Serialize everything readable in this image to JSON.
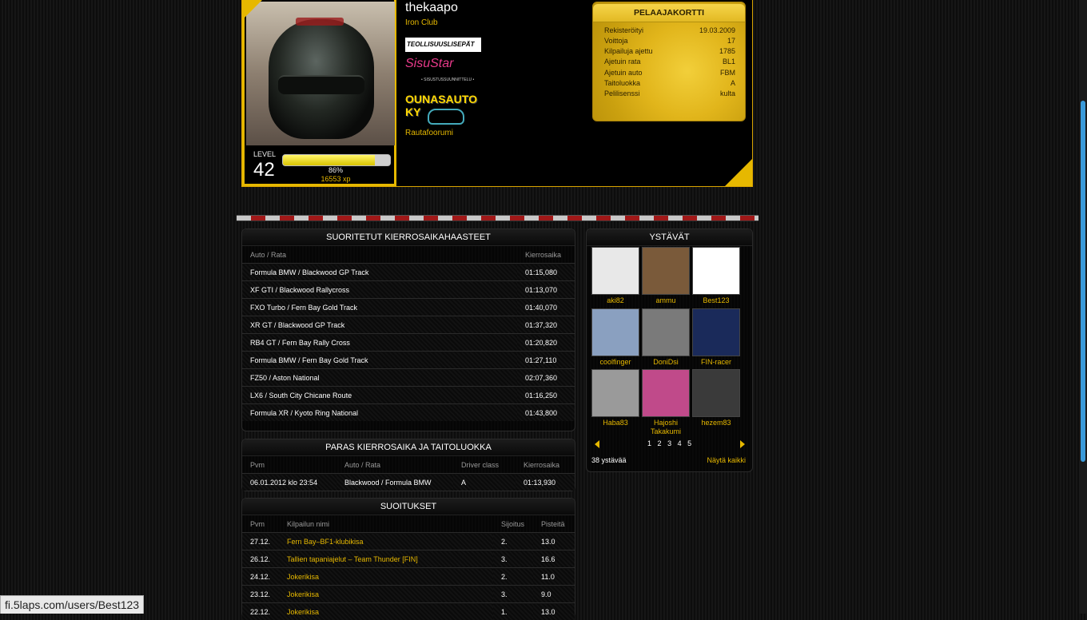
{
  "profile": {
    "username": "thekaapo",
    "club": "Iron Club",
    "level_label": "LEVEL",
    "level": "42",
    "xp_percent_text": "86%",
    "xp_progress": 0.86,
    "xp_text": "16553 xp",
    "sponsors": [
      "TEOLLISUUSLISEPÄT OY",
      "SisuStar",
      "OUNASAUTO KY"
    ],
    "sponsor2_tagline": "• SISUSTUSSUUNNITTELU •",
    "forum_link": "Rautafoorumi"
  },
  "card": {
    "title": "PELAAJAKORTTI",
    "rows": [
      {
        "label": "Rekisteröityi",
        "value": "19.03.2009"
      },
      {
        "label": "Voittoja",
        "value": "17"
      },
      {
        "label": "Kilpailuja ajettu",
        "value": "1785"
      },
      {
        "label": "Ajetuin rata",
        "value": "BL1"
      },
      {
        "label": "Ajetuin auto",
        "value": "FBM"
      },
      {
        "label": "Taitoluokka",
        "value": "A"
      },
      {
        "label": "Pelilisenssi",
        "value": "kulta"
      }
    ]
  },
  "laps": {
    "title": "SUORITETUT KIERROSAIKAHAASTEET",
    "headers": [
      "Auto / Rata",
      "Kierrosaika"
    ],
    "rows": [
      [
        "Formula BMW / Blackwood GP Track",
        "01:15,080"
      ],
      [
        "XF GTI / Blackwood Rallycross",
        "01:13,070"
      ],
      [
        "FXO Turbo / Fern Bay Gold Track",
        "01:40,070"
      ],
      [
        "XR GT / Blackwood GP Track",
        "01:37,320"
      ],
      [
        "RB4 GT / Fern Bay Rally Cross",
        "01:20,820"
      ],
      [
        "Formula BMW / Fern Bay Gold Track",
        "01:27,110"
      ],
      [
        "FZ50 / Aston National",
        "02:07,360"
      ],
      [
        "LX6 / South City Chicane Route",
        "01:16,250"
      ],
      [
        "Formula XR / Kyoto Ring National",
        "01:43,800"
      ]
    ]
  },
  "best": {
    "title": "PARAS KIERROSAIKA JA TAITOLUOKKA",
    "headers": [
      "Pvm",
      "Auto / Rata",
      "Driver class",
      "Kierrosaika"
    ],
    "row": [
      "06.01.2012 klo 23:54",
      "Blackwood / Formula BMW",
      "A",
      "01:13,930"
    ]
  },
  "results": {
    "title": "SUOITUKSET",
    "headers": [
      "Pvm",
      "Kilpailun nimi",
      "Sijoitus",
      "Pisteitä"
    ],
    "rows": [
      [
        "27.12.",
        "Fern Bay–BF1-klubikisa",
        "2.",
        "13.0"
      ],
      [
        "26.12.",
        "Tallien tapaniajelut – Team Thunder [FIN]",
        "3.",
        "16.6"
      ],
      [
        "24.12.",
        "Jokerikisa",
        "2.",
        "11.0"
      ],
      [
        "23.12.",
        "Jokerikisa",
        "3.",
        "9.0"
      ],
      [
        "22.12.",
        "Jokerikisa",
        "1.",
        "13.0"
      ]
    ]
  },
  "friends": {
    "title": "YSTÄVÄT",
    "list": [
      {
        "name": "aki82",
        "color": "#e8e8e8"
      },
      {
        "name": "ammu",
        "color": "#7a5a3a"
      },
      {
        "name": "Best123",
        "color": "#ffffff"
      },
      {
        "name": "coolfinger",
        "color": "#8aa0c0"
      },
      {
        "name": "DoniDsi",
        "color": "#7a7a7a"
      },
      {
        "name": "FIN-racer",
        "color": "#1a2a5a"
      },
      {
        "name": "Haba83",
        "color": "#9a9a9a"
      },
      {
        "name": "Hajoshi Takakumi",
        "color": "#c04a8a"
      },
      {
        "name": "hezem83",
        "color": "#3a3a3a"
      }
    ],
    "pages": [
      "1",
      "2",
      "3",
      "4",
      "5"
    ],
    "count_text": "38 ystävää",
    "show_all": "Näytä kaikki"
  },
  "status_url": "fi.5laps.com/users/Best123",
  "colors": {
    "accent": "#e6b800",
    "card_gold": "#e1b51b",
    "stripe_red": "#a01818"
  }
}
